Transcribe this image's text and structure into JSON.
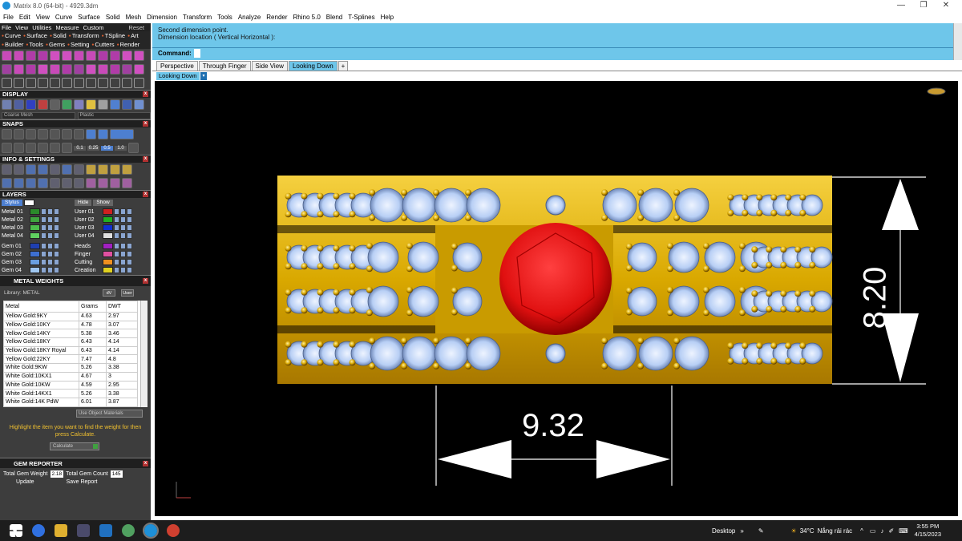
{
  "window": {
    "title": "Matrix 8.0 (64-bit) - 4929.3dm",
    "controls": [
      "—",
      "❐",
      "✕"
    ]
  },
  "menu": [
    "File",
    "Edit",
    "View",
    "Curve",
    "Surface",
    "Solid",
    "Mesh",
    "Dimension",
    "Transform",
    "Tools",
    "Analyze",
    "Render",
    "Rhino 5.0",
    "Blend",
    "T-Splines",
    "Help"
  ],
  "panel": {
    "control_menu": [
      "File",
      "View",
      "Utilities",
      "Measure",
      "Custom"
    ],
    "reset": "Reset",
    "tabs_row1": [
      "Curve",
      "Surface",
      "Solid",
      "Transform",
      "TSpline",
      "Art"
    ],
    "tabs_row2": [
      "Builder",
      "Tools",
      "Gems",
      "Setting",
      "Cutters",
      "Render"
    ],
    "display_title": "DISPLAY",
    "display_mesh": "Coarse Mesh",
    "display_material": "Plastic",
    "snaps_title": "SNAPS",
    "snap_values": [
      "0.1",
      "0.25",
      "0.5",
      "1.0"
    ],
    "info_title": "INFO & SETTINGS",
    "layers_title": "LAYERS",
    "layers_header": {
      "active": "Stylus",
      "hide": "Hide",
      "show": "Show"
    },
    "layers_left": [
      {
        "name": "Metal 01",
        "color": "#2b8a2b"
      },
      {
        "name": "Metal 02",
        "color": "#3fa53f"
      },
      {
        "name": "Metal 03",
        "color": "#4cbf4c"
      },
      {
        "name": "Metal 04",
        "color": "#60d060"
      },
      {
        "name": "Gem 01",
        "color": "#1f3fb0"
      },
      {
        "name": "Gem 02",
        "color": "#3d6fd0"
      },
      {
        "name": "Gem 03",
        "color": "#6a9fe0"
      },
      {
        "name": "Gem 04",
        "color": "#9fc6f0"
      }
    ],
    "layers_right": [
      {
        "name": "User 01",
        "color": "#d02020"
      },
      {
        "name": "User 02",
        "color": "#20b020"
      },
      {
        "name": "User 03",
        "color": "#1030d0"
      },
      {
        "name": "User 04",
        "color": "#e0e0e0"
      },
      {
        "name": "Heads",
        "color": "#a020c0"
      },
      {
        "name": "Finger",
        "color": "#e050a0"
      },
      {
        "name": "Cutting",
        "color": "#f09020"
      },
      {
        "name": "Creation",
        "color": "#e0d020"
      }
    ]
  },
  "metal_weights": {
    "title": "METAL WEIGHTS",
    "library_label": "Library: METAL",
    "buttons": [
      "dV",
      "User"
    ],
    "columns": [
      "Metal",
      "Grams",
      "DWT"
    ],
    "rows": [
      [
        "Yellow Gold:9KY",
        "4.63",
        "2.97"
      ],
      [
        "Yellow Gold:10KY",
        "4.78",
        "3.07"
      ],
      [
        "Yellow Gold:14KY",
        "5.38",
        "3.46"
      ],
      [
        "Yellow Gold:18KY",
        "6.43",
        "4.14"
      ],
      [
        "Yellow Gold:18KY Royal",
        "6.43",
        "4.14"
      ],
      [
        "Yellow Gold:22KY",
        "7.47",
        "4.8"
      ],
      [
        "White Gold:9KW",
        "5.26",
        "3.38"
      ],
      [
        "White Gold:10KX1",
        "4.67",
        "3"
      ],
      [
        "White Gold:10KW",
        "4.59",
        "2.95"
      ],
      [
        "White Gold:14KX1",
        "5.26",
        "3.38"
      ],
      [
        "White Gold:14K PdW",
        "6.01",
        "3.87"
      ]
    ],
    "use_object_materials": "Use Object Materials",
    "hint": "Highlight the item you want to find the weight for then press Calculate.",
    "calculate": "Calculate"
  },
  "gem_reporter": {
    "title": "GEM REPORTER",
    "total_weight_label": "Total Gem Weight",
    "total_weight": "2.18",
    "total_count_label": "Total Gem Count",
    "total_count": "145",
    "update": "Update",
    "save_report": "Save Report"
  },
  "command": {
    "history": [
      "Second dimension point.",
      "Dimension location ( Vertical  Horizontal ):"
    ],
    "prompt": "Command:"
  },
  "viewport_tabs": [
    "Perspective",
    "Through Finger",
    "Side View",
    "Looking Down",
    "+"
  ],
  "active_view": "Looking Down",
  "dimensions": {
    "horizontal": "9.32",
    "vertical": "8.20"
  },
  "taskbar": {
    "desktop": "Desktop",
    "weather_temp": "34°C",
    "weather_text": "Nắng rải rác",
    "time": "3:55 PM",
    "date": "4/15/2023"
  },
  "colors": {
    "accent_blue": "#6ec6ea",
    "gold": "#d9a800",
    "ruby": "#e01010",
    "diamond": "#c8dcff"
  }
}
